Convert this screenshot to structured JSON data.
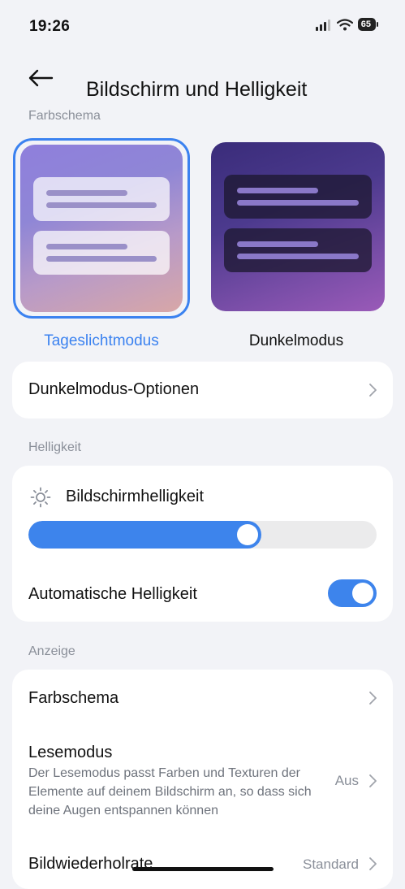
{
  "status": {
    "time": "19:26",
    "battery": "65",
    "icons": [
      "signal-icon",
      "wifi-icon",
      "battery-icon"
    ]
  },
  "header": {
    "title": "Bildschirm und Helligkeit",
    "back_icon": "back-arrow-icon"
  },
  "color_scheme_section": {
    "label": "Farbschema",
    "options": [
      {
        "label": "Tageslichtmodus",
        "selected": true
      },
      {
        "label": "Dunkelmodus",
        "selected": false
      }
    ]
  },
  "dark_mode_options": {
    "label": "Dunkelmodus-Optionen"
  },
  "brightness_section": {
    "label": "Helligkeit",
    "brightness_label": "Bildschirmhelligkeit",
    "brightness_level_percent": 67,
    "auto_label": "Automatische Helligkeit",
    "auto_enabled": true
  },
  "display_section": {
    "label": "Anzeige",
    "items": [
      {
        "title": "Farbschema"
      },
      {
        "title": "Lesemodus",
        "description": "Der Lesemodus passt Farben und Texturen der Elemente auf deinem Bildschirm an, so dass sich deine Augen entspannen können",
        "value": "Aus"
      },
      {
        "title": "Bildwiederholrate",
        "value": "Standard"
      }
    ]
  },
  "colors": {
    "accent": "#3b82f0",
    "background": "#f2f3f7",
    "card": "#ffffff",
    "secondary_text": "#8a8f99"
  }
}
